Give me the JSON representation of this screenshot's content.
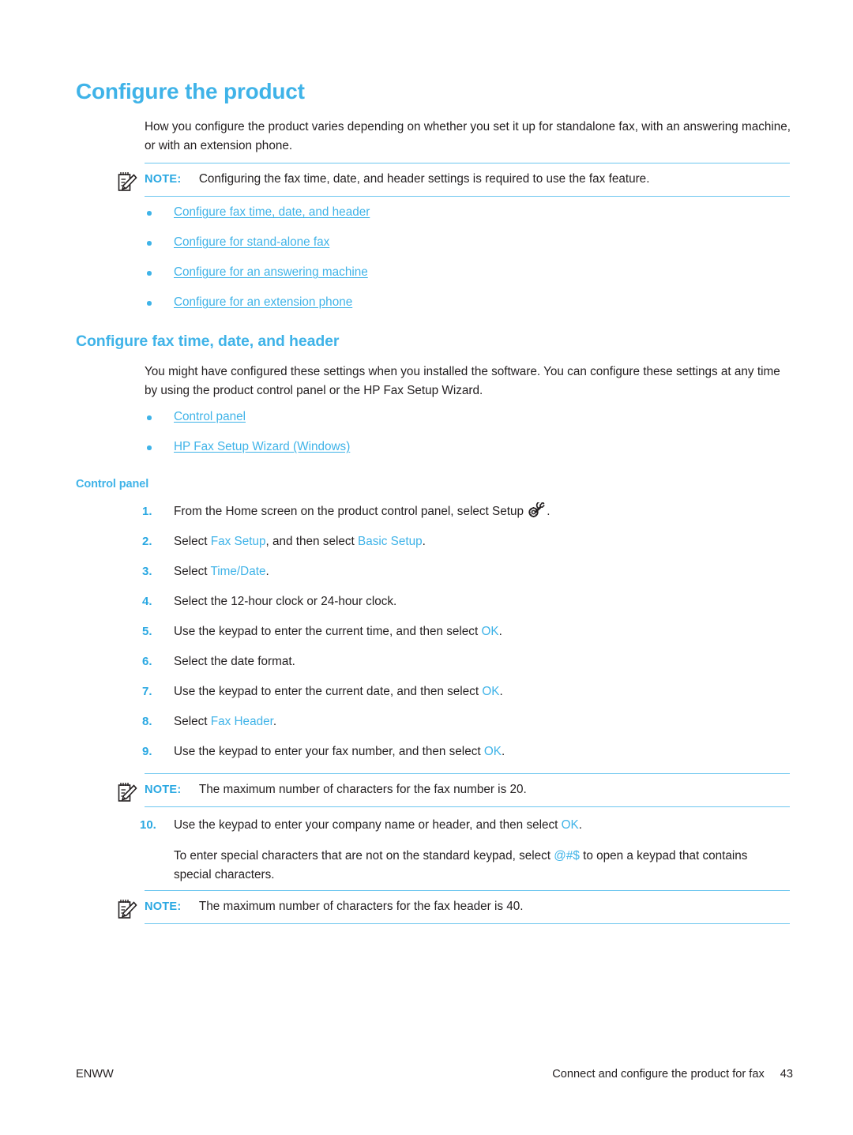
{
  "page": {
    "title": "Configure the product",
    "intro": "How you configure the product varies depending on whether you set it up for standalone fax, with an answering machine, or with an extension phone.",
    "note_label": "NOTE:",
    "note_icon": "note-pencil-icon",
    "note1_text": "Configuring the fax time, date, and header settings is required to use the fax feature.",
    "links": [
      "Configure fax time, date, and header",
      "Configure for stand-alone fax",
      "Configure for an answering machine",
      "Configure for an extension phone"
    ],
    "section2": {
      "heading": "Configure fax time, date, and header",
      "paragraph": "You might have configured these settings when you installed the software. You can configure these settings at any time by using the product control panel or the HP Fax Setup Wizard.",
      "links": [
        "Control panel",
        "HP Fax Setup Wizard (Windows)"
      ],
      "subheading": "Control panel"
    },
    "steps": [
      {
        "num": "1.",
        "parts": [
          {
            "t": "From the Home screen on the product control panel, select Setup ",
            "style": "plain"
          },
          {
            "t": "setup-gear-wrench-icon",
            "style": "icon"
          },
          {
            "t": ".",
            "style": "plain"
          }
        ]
      },
      {
        "num": "2.",
        "parts": [
          {
            "t": "Select ",
            "style": "plain"
          },
          {
            "t": "Fax Setup",
            "style": "kw"
          },
          {
            "t": ", and then select ",
            "style": "plain"
          },
          {
            "t": "Basic Setup",
            "style": "kw"
          },
          {
            "t": ".",
            "style": "plain"
          }
        ]
      },
      {
        "num": "3.",
        "parts": [
          {
            "t": "Select ",
            "style": "plain"
          },
          {
            "t": "Time/Date",
            "style": "kw"
          },
          {
            "t": ".",
            "style": "plain"
          }
        ]
      },
      {
        "num": "4.",
        "parts": [
          {
            "t": "Select the 12-hour clock or 24-hour clock.",
            "style": "plain"
          }
        ]
      },
      {
        "num": "5.",
        "parts": [
          {
            "t": "Use the keypad to enter the current time, and then select ",
            "style": "plain"
          },
          {
            "t": "OK",
            "style": "kw"
          },
          {
            "t": ".",
            "style": "plain"
          }
        ]
      },
      {
        "num": "6.",
        "parts": [
          {
            "t": "Select the date format.",
            "style": "plain"
          }
        ]
      },
      {
        "num": "7.",
        "parts": [
          {
            "t": "Use the keypad to enter the current date, and then select ",
            "style": "plain"
          },
          {
            "t": "OK",
            "style": "kw"
          },
          {
            "t": ".",
            "style": "plain"
          }
        ]
      },
      {
        "num": "8.",
        "parts": [
          {
            "t": "Select ",
            "style": "plain"
          },
          {
            "t": "Fax Header",
            "style": "kw"
          },
          {
            "t": ".",
            "style": "plain"
          }
        ]
      },
      {
        "num": "9.",
        "parts": [
          {
            "t": "Use the keypad to enter your fax number, and then select ",
            "style": "plain"
          },
          {
            "t": "OK",
            "style": "kw"
          },
          {
            "t": ".",
            "style": "plain"
          }
        ]
      }
    ],
    "note2_text": "The maximum number of characters for the fax number is 20.",
    "step10": {
      "num": "10.",
      "parts": [
        {
          "t": "Use the keypad to enter your company name or header, and then select ",
          "style": "plain"
        },
        {
          "t": "OK",
          "style": "kw"
        },
        {
          "t": ".",
          "style": "plain"
        }
      ]
    },
    "step10_sub": [
      {
        "t": "To enter special characters that are not on the standard keypad, select ",
        "style": "plain"
      },
      {
        "t": "@#$",
        "style": "kw"
      },
      {
        "t": " to open a keypad that contains special characters.",
        "style": "plain"
      }
    ],
    "note3_text": "The maximum number of characters for the fax header is 40.",
    "footer": {
      "left": "ENWW",
      "right": "Connect and configure the product for fax",
      "page_number": "43"
    },
    "colors": {
      "accent_blue": "#3fb3e8",
      "note_rule": "#6cc6ef",
      "body_text": "#231f20"
    }
  }
}
